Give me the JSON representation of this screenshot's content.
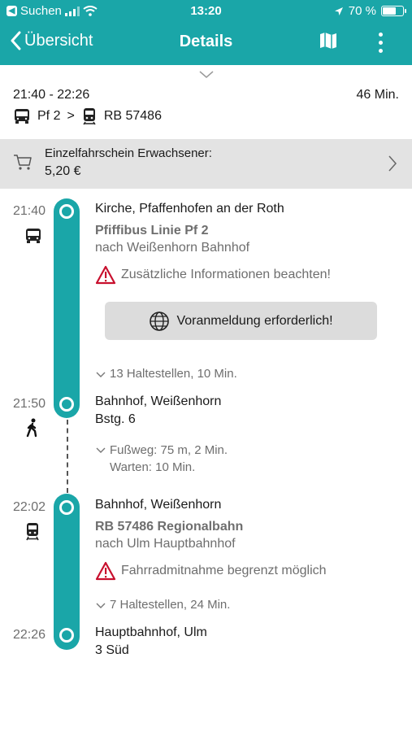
{
  "status_bar": {
    "carrier": "Suchen",
    "time": "13:20",
    "battery": "70 %",
    "battery_level": 0.7
  },
  "nav": {
    "back_label": "Übersicht",
    "title": "Details"
  },
  "summary": {
    "time_range": "21:40 - 22:26",
    "duration": "46 Min.",
    "leg1": "Pf 2",
    "separator": ">",
    "leg2": "RB 57486"
  },
  "ticket": {
    "name": "Einzelfahrschein Erwachsener:",
    "price": "5,20 €"
  },
  "legs": [
    {
      "dep_time": "21:40",
      "dep_stop": "Kirche, Pfaffenhofen an der Roth",
      "line": "Pfiffibus Linie Pf 2",
      "direction": "nach Weißenhorn Bahnhof",
      "notice": "Zusätzliche Informationen beachten!",
      "button": "Voranmeldung erforderlich!",
      "stops_info": "13 Haltestellen, 10 Min.",
      "arr_time": "21:50",
      "arr_stop": "Bahnhof, Weißenhorn",
      "arr_platform": "Bstg. 6"
    },
    {
      "dep_time": "22:02",
      "dep_stop": "Bahnhof, Weißenhorn",
      "line": "RB 57486 Regionalbahn",
      "direction": "nach Ulm Hauptbahnhof",
      "notice": "Fahrradmitnahme begrenzt möglich",
      "stops_info": "7 Haltestellen, 24 Min.",
      "arr_time": "22:26",
      "arr_stop": "Hauptbahnhof, Ulm",
      "arr_platform": "3 Süd"
    }
  ],
  "walk": {
    "distance": "Fußweg: 75 m, 2 Min.",
    "wait": "Warten: 10 Min."
  },
  "colors": {
    "accent": "#1aa6a8",
    "warning": "#c8102e"
  }
}
